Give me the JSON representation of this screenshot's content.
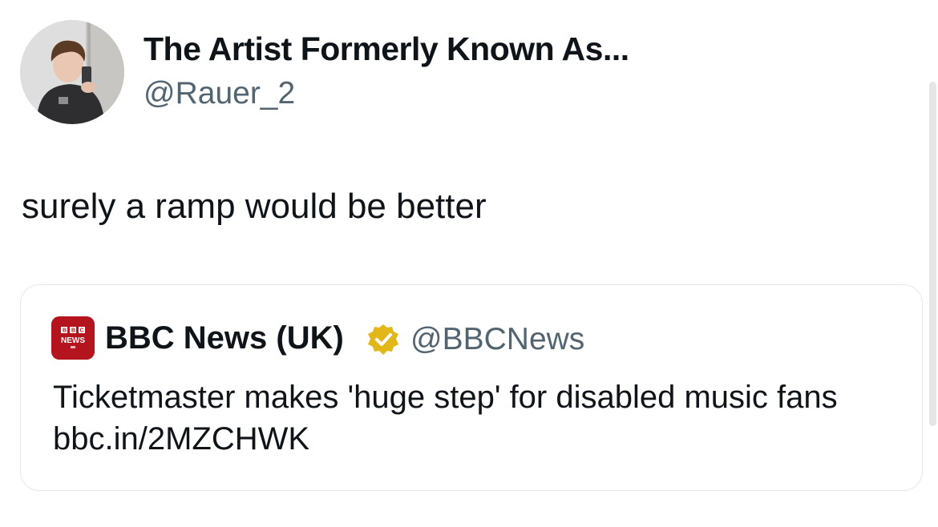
{
  "tweet": {
    "author_name": "The Artist Formerly Known As...",
    "author_handle": "@Rauer_2",
    "text": "surely a ramp would be better"
  },
  "quoted_tweet": {
    "logo_text": "BBC NEWS",
    "author_name": "BBC News (UK)",
    "verified_badge": "gold-verified-icon",
    "author_handle": "@BBCNews",
    "text": "Ticketmaster makes 'huge step' for disabled music fans bbc.in/2MZCHWK"
  },
  "colors": {
    "primary_text": "#0f1419",
    "secondary_text": "#536471",
    "bbc_red": "#b4141e",
    "badge_gold": "#e2b719",
    "card_border": "#e4e8eb"
  }
}
